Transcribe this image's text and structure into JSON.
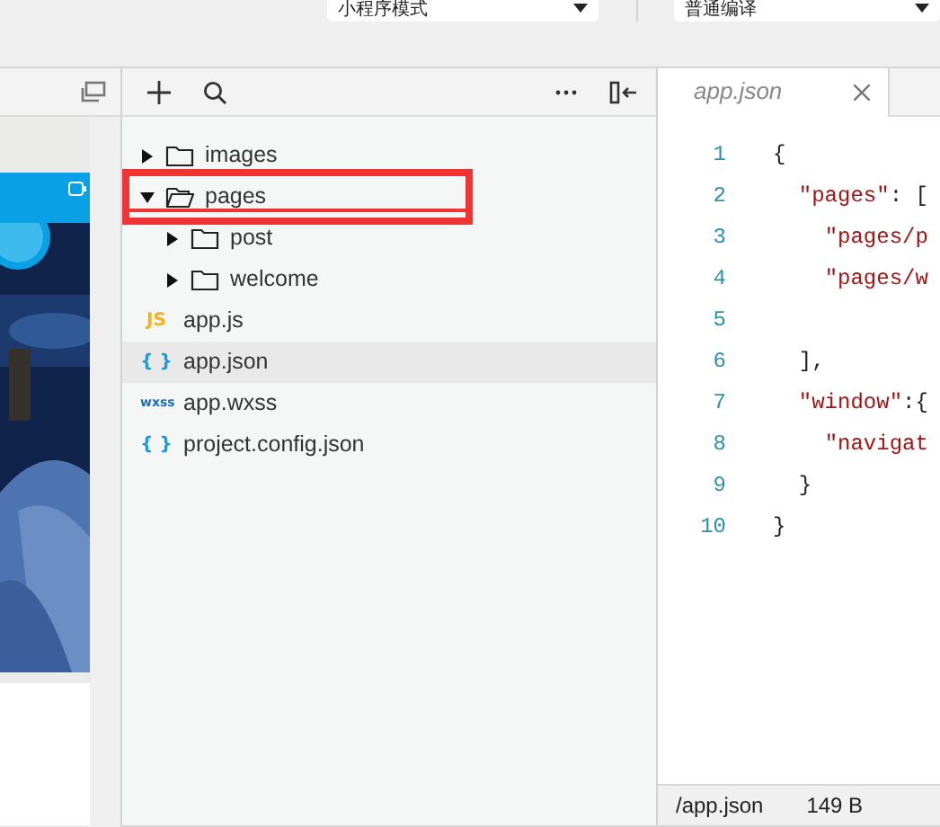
{
  "toolbar": {
    "dropdowns": [
      {
        "value": "小程序模式"
      },
      {
        "value": "普通编译"
      }
    ]
  },
  "explorer": {
    "tree": [
      {
        "label": "images",
        "kind": "folder",
        "expanded": false,
        "selected": false
      },
      {
        "label": "pages",
        "kind": "folder",
        "expanded": true,
        "selected": false,
        "highlighted": true,
        "children": [
          {
            "label": "post",
            "kind": "folder",
            "expanded": false,
            "selected": false
          },
          {
            "label": "welcome",
            "kind": "folder",
            "expanded": false,
            "selected": false
          }
        ]
      },
      {
        "label": "app.js",
        "kind": "js",
        "icon": "JS",
        "selected": false
      },
      {
        "label": "app.json",
        "kind": "json",
        "icon": "{ }",
        "selected": true
      },
      {
        "label": "app.wxss",
        "kind": "wxss",
        "icon": "wxss",
        "selected": false
      },
      {
        "label": "project.config.json",
        "kind": "json",
        "icon": "{ }",
        "selected": false
      }
    ]
  },
  "editor": {
    "tabs": [
      {
        "label": "app.json",
        "selected": true
      }
    ],
    "lines": [
      {
        "number": "1",
        "code": "{"
      },
      {
        "number": "2",
        "code": "  \"pages\": ["
      },
      {
        "number": "3",
        "code": "    \"pages/p"
      },
      {
        "number": "4",
        "code": "    \"pages/w"
      },
      {
        "number": "5"
      },
      {
        "number": "6",
        "code": "  ],"
      },
      {
        "number": "7",
        "code": "  \"window\":{"
      },
      {
        "number": "8",
        "code": "    \"navigat"
      },
      {
        "number": "9",
        "code": "  }"
      },
      {
        "number": "10",
        "code": "}"
      }
    ]
  },
  "status_bar": {
    "path": "/app.json",
    "size": "149 B"
  }
}
